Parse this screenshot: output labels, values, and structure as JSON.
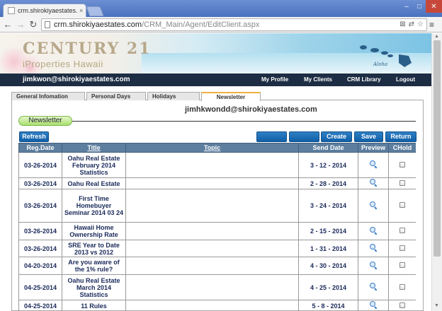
{
  "browser": {
    "tab_title": "crm.shirokiyaestates.com",
    "tab_close": "×",
    "url_host": "crm.shirokiyaestates.com",
    "url_path": "/CRM_Main/Agent/EditClient.aspx",
    "win_min": "–",
    "win_max": "□",
    "win_close": "✕"
  },
  "banner": {
    "logo": "CENTURY 21",
    "logo_sub": "iProperties Hawaii",
    "tagline": "Aloha"
  },
  "navbar": {
    "user_email": "jimkwon@shirokiyaestates.com",
    "links": [
      "My Profile",
      "My Clients",
      "CRM Library",
      "Logout"
    ]
  },
  "tabs": [
    "General Infomation",
    "Personal Days",
    "Holidays",
    "Newsletter"
  ],
  "active_tab": "Newsletter",
  "panel": {
    "owner_email": "jimhkwondd@shirokiyaestates.com",
    "section_label": "Newsletter"
  },
  "buttons": {
    "refresh": "Refresh",
    "blank1": "",
    "blank2": "",
    "create": "Create",
    "save": "Save",
    "return": "Return"
  },
  "grid": {
    "headers": [
      "Reg.Date",
      "Title",
      "Topic",
      "Send Date",
      "Preview",
      "CHold"
    ],
    "rows": [
      {
        "reg_date": "03-26-2014",
        "title": "Oahu Real Estate February 2014 Statistics",
        "topic": "",
        "send_date": "3 - 12 - 2014"
      },
      {
        "reg_date": "03-26-2014",
        "title": "Oahu Real Estate",
        "topic": "",
        "send_date": "2 - 28 - 2014"
      },
      {
        "reg_date": "03-26-2014",
        "title": "First Time Homebuyer Seminar 2014 03 24",
        "topic": "",
        "send_date": "3 - 24 - 2014"
      },
      {
        "reg_date": "03-26-2014",
        "title": "Hawaii Home Ownership Rate",
        "topic": "",
        "send_date": "2 - 15 - 2014"
      },
      {
        "reg_date": "03-26-2014",
        "title": "SRE Year to Date 2013 vs 2012",
        "topic": "",
        "send_date": "1 - 31 - 2014"
      },
      {
        "reg_date": "04-20-2014",
        "title": "Are you aware of the 1% rule?",
        "topic": "",
        "send_date": "4 - 30 - 2014"
      },
      {
        "reg_date": "04-25-2014",
        "title": "Oahu Real Estate March 2014 Statistics",
        "topic": "",
        "send_date": "4 - 25 - 2014"
      },
      {
        "reg_date": "04-25-2014",
        "title": "11 Rules",
        "topic": "",
        "send_date": "5 - 8 - 2014"
      }
    ]
  },
  "colors": {
    "navbar_bg": "#1d2d43",
    "header_bg": "#5d7e9e",
    "button_bg": "#1a6cb4",
    "pill_green": "#a9df6e"
  },
  "icons": {
    "preview": "search-icon",
    "back": "back-arrow-icon",
    "forward": "forward-arrow-icon",
    "reload": "reload-icon",
    "menu": "hamburger-menu-icon"
  }
}
